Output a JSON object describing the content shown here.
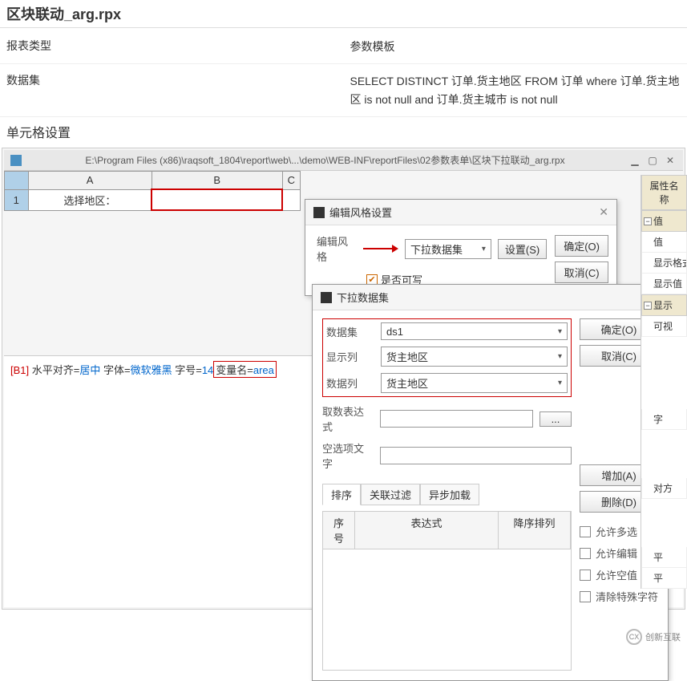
{
  "page_title": "区块联动_arg.rpx",
  "info": {
    "type_label": "报表类型",
    "type_value": "参数模板",
    "ds_label": "数据集",
    "ds_value": "SELECT DISTINCT 订单.货主地区 FROM 订单 where 订单.货主地区 is not null and 订单.货主城市 is not null"
  },
  "section_cell": "单元格设置",
  "titlebar": {
    "path": "E:\\Program Files (x86)\\raqsoft_1804\\report\\web\\...\\demo\\WEB-INF\\reportFiles\\02参数表单\\区块下拉联动_arg.rpx"
  },
  "grid": {
    "col_a": "A",
    "col_b": "B",
    "col_c": "C",
    "row1": "1",
    "a1": "选择地区："
  },
  "status": {
    "cell": "[B1]",
    "t1": " 水平对齐=",
    "v1": "居中",
    "t2": " 字体=",
    "v2": "微软雅黑",
    "t3": " 字号=",
    "v3": "14",
    "t4": " 变量名=",
    "v4": "area"
  },
  "dialog1": {
    "title": "编辑风格设置",
    "label_style": "编辑风格",
    "style_value": "下拉数据集",
    "btn_set": "设置(S)",
    "chk_writable": "是否可写",
    "btn_ok": "确定(O)",
    "btn_cancel": "取消(C)"
  },
  "dialog2": {
    "title": "下拉数据集",
    "lbl_ds": "数据集",
    "val_ds": "ds1",
    "lbl_disp": "显示列",
    "val_disp": "货主地区",
    "lbl_data": "数据列",
    "val_data": "货主地区",
    "lbl_fetch": "取数表达式",
    "lbl_empty": "空选项文字",
    "tab_sort": "排序",
    "tab_filter": "关联过滤",
    "tab_async": "异步加载",
    "col_idx": "序号",
    "col_exp": "表达式",
    "col_sort": "降序排列",
    "btn_ok": "确定(O)",
    "btn_cancel": "取消(C)",
    "btn_add": "增加(A)",
    "btn_del": "删除(D)",
    "chk_multi": "允许多选",
    "chk_edit": "允许编辑",
    "chk_null": "允许空值",
    "chk_clear": "清除特殊字符"
  },
  "prop": {
    "header": "属性名称",
    "g1": "值",
    "i1": "值",
    "i2": "显示格式",
    "i3": "显示值",
    "g2": "显示",
    "i4": "可视",
    "i5": "字",
    "i6": "对方",
    "i7": "平",
    "i8": "平"
  },
  "logo": {
    "text": "创新互联",
    "sub": "CX"
  }
}
